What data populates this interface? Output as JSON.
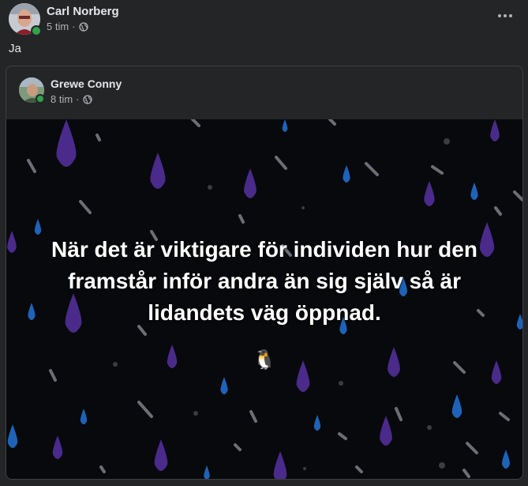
{
  "post": {
    "author": "Carl Norberg",
    "time": "5 tim",
    "text": "Ja",
    "more_label": "Fler alternativ"
  },
  "shared_post": {
    "author": "Grewe Conny",
    "time": "8 tim",
    "quote": "När det är viktigare för individen hur den framstår inför andra än sig själv så är lidandets väg öppnad.",
    "emoji": "🐧"
  },
  "colors": {
    "background": "#242526",
    "image_background": "#07090c",
    "online": "#31a24c",
    "drop_purple": "#4a2a8a",
    "drop_blue": "#1e63b8",
    "streak_gray": "#6b6f75"
  },
  "icons": {
    "audience": "globe-icon",
    "more": "more-horizontal-icon",
    "emoji": "penguin"
  }
}
